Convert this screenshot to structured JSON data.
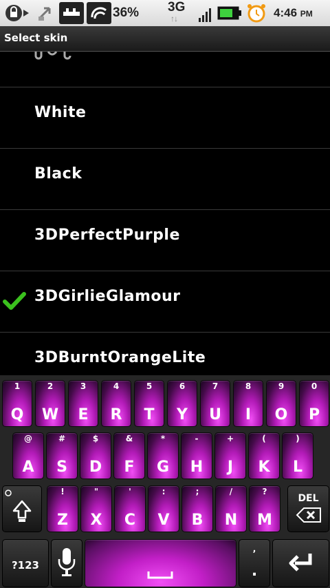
{
  "status_bar": {
    "battery_percent": "36%",
    "network": "3G",
    "network_arrows": "↑↓",
    "time": "4:46",
    "ampm": "PM"
  },
  "dialog": {
    "title": "Select skin"
  },
  "skins": {
    "items": [
      {
        "label": "White",
        "selected": false
      },
      {
        "label": "Black",
        "selected": false
      },
      {
        "label": "3DPerfectPurple",
        "selected": false
      },
      {
        "label": "3DGirlieGlamour",
        "selected": true
      },
      {
        "label": "3DBurntOrangeLite",
        "selected": false
      }
    ]
  },
  "keyboard": {
    "row1": [
      {
        "main": "Q",
        "sub": "1"
      },
      {
        "main": "W",
        "sub": "2"
      },
      {
        "main": "E",
        "sub": "3"
      },
      {
        "main": "R",
        "sub": "4"
      },
      {
        "main": "T",
        "sub": "5"
      },
      {
        "main": "Y",
        "sub": "6"
      },
      {
        "main": "U",
        "sub": "7"
      },
      {
        "main": "I",
        "sub": "8"
      },
      {
        "main": "O",
        "sub": "9"
      },
      {
        "main": "P",
        "sub": "0"
      }
    ],
    "row2": [
      {
        "main": "A",
        "sub": "@"
      },
      {
        "main": "S",
        "sub": "#"
      },
      {
        "main": "D",
        "sub": "$"
      },
      {
        "main": "F",
        "sub": "&"
      },
      {
        "main": "G",
        "sub": "*"
      },
      {
        "main": "H",
        "sub": "-"
      },
      {
        "main": "J",
        "sub": "+"
      },
      {
        "main": "K",
        "sub": "("
      },
      {
        "main": "L",
        "sub": ")"
      }
    ],
    "row3": [
      {
        "main": "Z",
        "sub": "!"
      },
      {
        "main": "X",
        "sub": "\""
      },
      {
        "main": "C",
        "sub": "'"
      },
      {
        "main": "V",
        "sub": ":"
      },
      {
        "main": "B",
        "sub": ";"
      },
      {
        "main": "N",
        "sub": "/"
      },
      {
        "main": "M",
        "sub": "?"
      }
    ],
    "symbols_label": "?123",
    "delete_label": "DEL",
    "period_label": ".",
    "comma_label": ","
  },
  "colors": {
    "accent_magenta": "#d01ed6",
    "check_green": "#3bc11e"
  }
}
